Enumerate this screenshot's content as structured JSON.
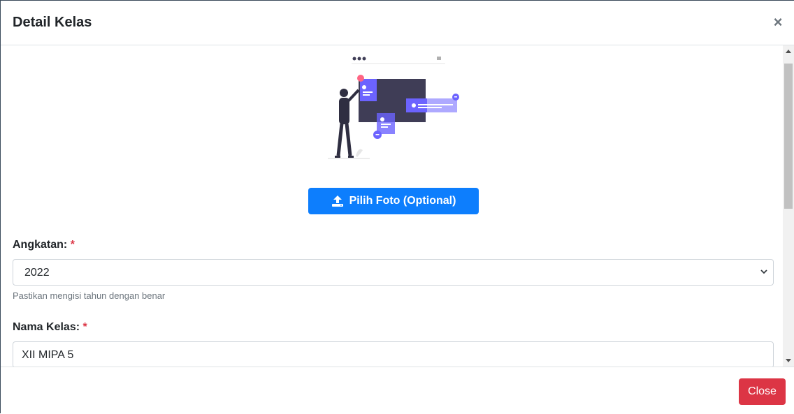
{
  "modal": {
    "title": "Detail Kelas",
    "close_symbol": "×"
  },
  "upload": {
    "label": "Pilih Foto (Optional)",
    "icon": "upload-icon"
  },
  "form": {
    "angkatan": {
      "label": "Angkatan:",
      "required_mark": "*",
      "selected": "2022",
      "help": "Pastikan mengisi tahun dengan benar"
    },
    "nama_kelas": {
      "label": "Nama Kelas:",
      "required_mark": "*",
      "value": "XII MIPA 5"
    }
  },
  "footer": {
    "close_label": "Close"
  },
  "colors": {
    "primary": "#0d7efd",
    "danger": "#dc3545",
    "illustration_accent": "#6c63ff",
    "illustration_dark": "#3f3d56"
  }
}
